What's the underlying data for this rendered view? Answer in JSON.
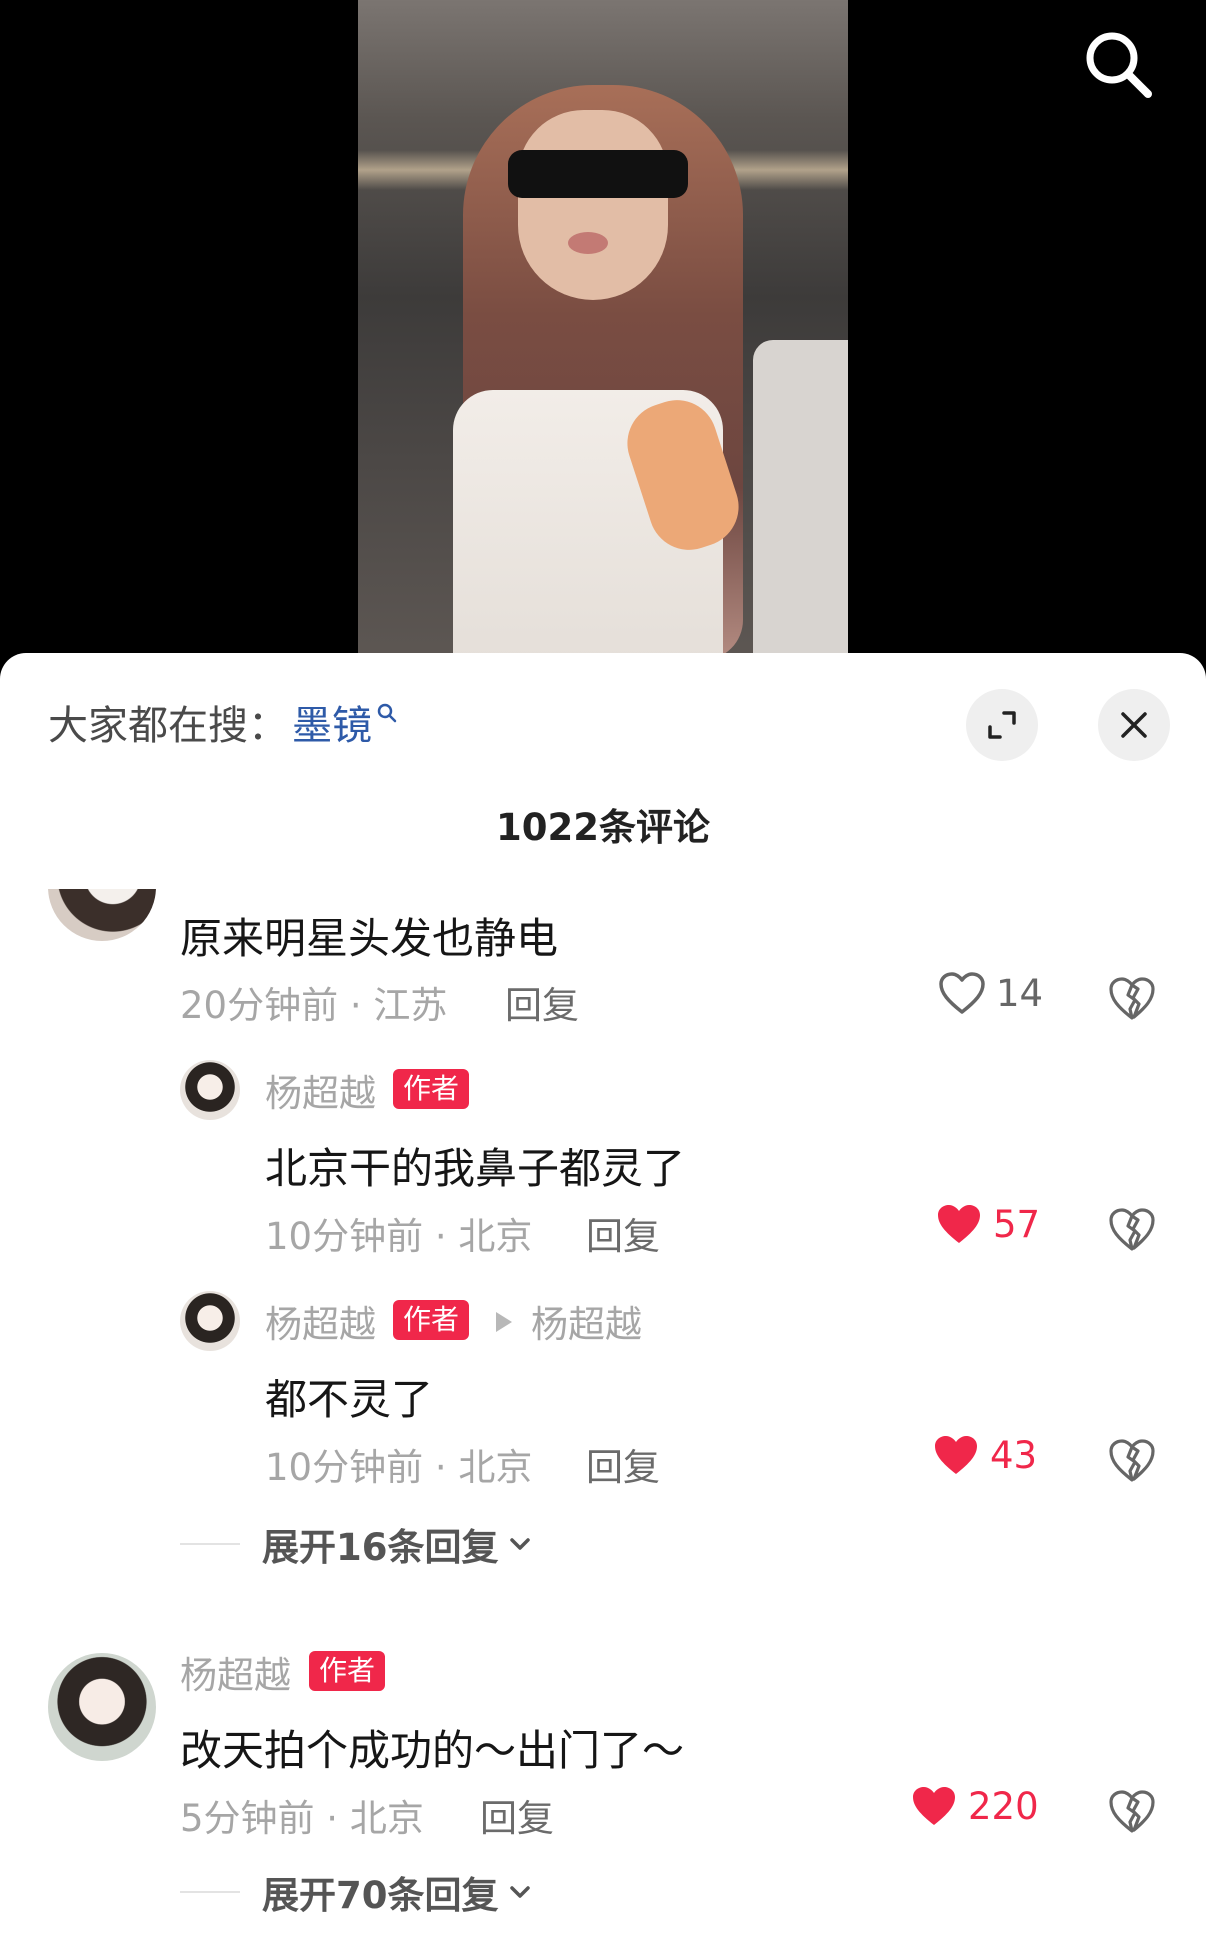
{
  "hot_search": {
    "prefix": "大家都在搜：",
    "term": "墨镜"
  },
  "comment_count_title": "1022条评论",
  "comments": [
    {
      "text": "原来明星头发也静电",
      "meta": "20分钟前 · 江苏",
      "reply_label": "回复",
      "likes": "14",
      "liked": false,
      "replies": [
        {
          "author": "杨超越",
          "badge": "作者",
          "text": "北京干的我鼻子都灵了",
          "meta": "10分钟前 · 北京",
          "reply_label": "回复",
          "likes": "57",
          "liked": true
        },
        {
          "author": "杨超越",
          "badge": "作者",
          "reply_to": "杨超越",
          "text": "都不灵了",
          "meta": "10分钟前 · 北京",
          "reply_label": "回复",
          "likes": "43",
          "liked": true
        }
      ],
      "expand_label": "展开16条回复"
    },
    {
      "author": "杨超越",
      "badge": "作者",
      "text": "改天拍个成功的～出门了～",
      "meta": "5分钟前 · 北京",
      "reply_label": "回复",
      "likes": "220",
      "liked": true,
      "expand_label": "展开70条回复"
    }
  ],
  "colors": {
    "accent_red": "#f0274a",
    "link_blue": "#2e5aa8"
  },
  "icons": [
    "search-icon",
    "expand-icon",
    "close-icon",
    "heart-icon",
    "broken-heart-icon",
    "chevron-down-icon"
  ]
}
